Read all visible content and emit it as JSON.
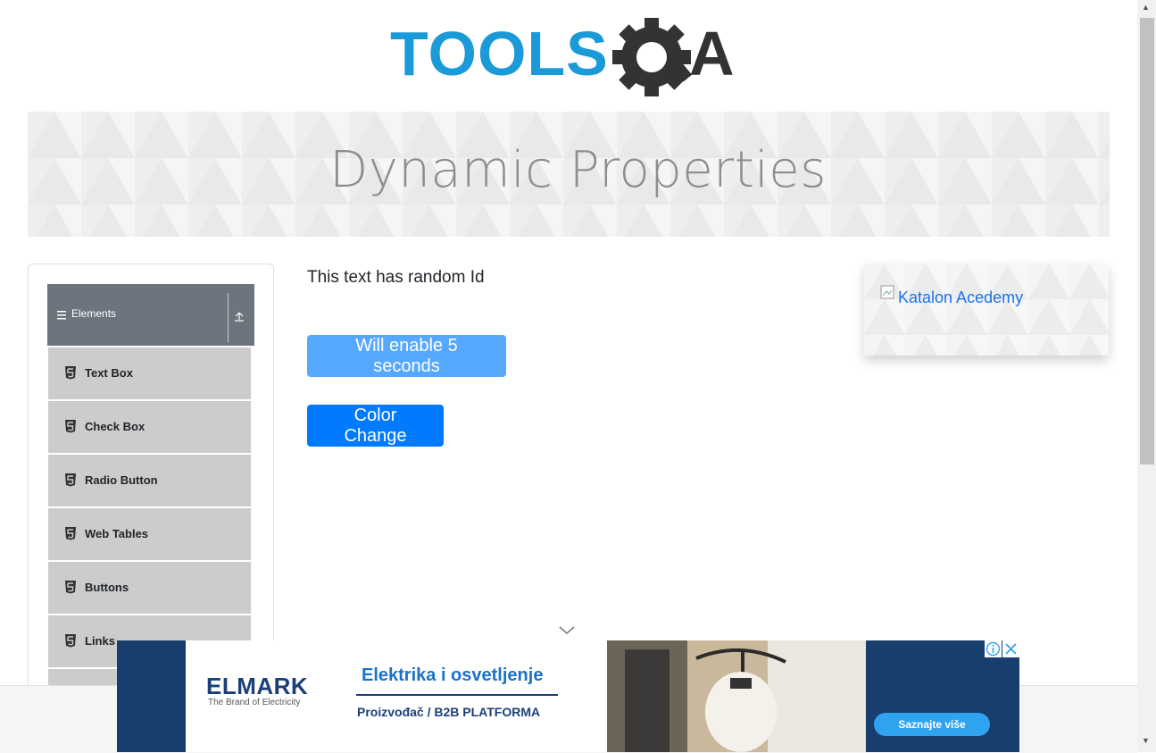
{
  "logo": {
    "alt": "TOOLSQA",
    "text_left": "TOOLS",
    "text_right": "A"
  },
  "banner": {
    "title": "Dynamic Properties"
  },
  "sidebar": {
    "group_label": "Elements",
    "items": [
      {
        "label": "Text Box"
      },
      {
        "label": "Check Box"
      },
      {
        "label": "Radio Button"
      },
      {
        "label": "Web Tables"
      },
      {
        "label": "Buttons"
      },
      {
        "label": "Links"
      }
    ]
  },
  "main": {
    "random_text": "This text has random Id",
    "enable_button": "Will enable 5 seconds",
    "color_button": "Color Change"
  },
  "side_ad": {
    "alt": "Katalon Acedemy"
  },
  "bottom_ad": {
    "brand": "ELMARK",
    "brand_tagline": "The Brand of Electricity",
    "headline": "Elektrika i osvetljenje",
    "subline": "Proizvođač / B2B PLATFORMA",
    "cta": "Saznajte više"
  },
  "colors": {
    "primary": "#007bff",
    "disabled_primary": "#56a8ff",
    "sidebar_header": "#6c757d",
    "menu_item": "#cccccc",
    "logo_blue": "#1b9ad8",
    "logo_dark": "#333333"
  }
}
